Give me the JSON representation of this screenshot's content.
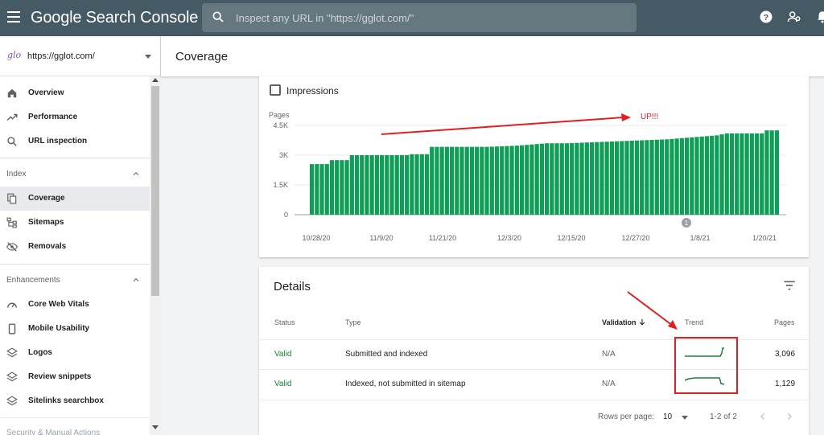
{
  "app": {
    "title": "Google Search Console",
    "search_placeholder": "Inspect any URL in \"https://gglot.com/\""
  },
  "sidebar": {
    "property_logo": "glo",
    "property": "https://gglot.com/",
    "items_top": [
      {
        "label": "Overview",
        "icon": "home-icon"
      },
      {
        "label": "Performance",
        "icon": "trending-up-icon"
      },
      {
        "label": "URL inspection",
        "icon": "search-icon"
      }
    ],
    "index_section": "Index",
    "index_items": [
      {
        "label": "Coverage",
        "icon": "file-copy-icon",
        "active": true
      },
      {
        "label": "Sitemaps",
        "icon": "sitemap-icon"
      },
      {
        "label": "Removals",
        "icon": "visibility-off-icon"
      }
    ],
    "enh_section": "Enhancements",
    "enh_items": [
      {
        "label": "Core Web Vitals",
        "icon": "speed-icon"
      },
      {
        "label": "Mobile Usability",
        "icon": "phone-icon"
      },
      {
        "label": "Logos",
        "icon": "layers-icon"
      },
      {
        "label": "Review snippets",
        "icon": "layers-icon"
      },
      {
        "label": "Sitelinks searchbox",
        "icon": "layers-icon"
      }
    ],
    "cut_item": "Security & Manual Actions"
  },
  "header": {
    "title": "Coverage"
  },
  "chart": {
    "checkbox_label": "Impressions",
    "checked": false,
    "annotation_marker": "1",
    "annotation_text": "UP!!!"
  },
  "chart_data": {
    "type": "bar",
    "ylabel": "Pages",
    "yticks": [
      "0",
      "1.5K",
      "3K",
      "4.5K"
    ],
    "ylim": [
      0,
      4500
    ],
    "xticks": [
      "10/28/20",
      "11/9/20",
      "11/21/20",
      "12/3/20",
      "12/15/20",
      "12/27/20",
      "1/8/21",
      "1/20/21"
    ],
    "color": "#0f9d58",
    "values": [
      2550,
      2550,
      2550,
      2550,
      2750,
      2750,
      2750,
      2750,
      3000,
      3000,
      3000,
      3000,
      3000,
      3000,
      3000,
      3000,
      3000,
      3000,
      3000,
      3000,
      3050,
      3050,
      3050,
      3050,
      3420,
      3420,
      3420,
      3420,
      3420,
      3420,
      3420,
      3420,
      3420,
      3420,
      3420,
      3420,
      3430,
      3440,
      3450,
      3460,
      3470,
      3480,
      3500,
      3520,
      3540,
      3560,
      3580,
      3600,
      3600,
      3600,
      3600,
      3600,
      3610,
      3620,
      3630,
      3640,
      3650,
      3660,
      3670,
      3680,
      3690,
      3700,
      3710,
      3720,
      3730,
      3740,
      3750,
      3760,
      3770,
      3780,
      3790,
      3800,
      3820,
      3840,
      3860,
      3880,
      3900,
      3920,
      3940,
      3960,
      3980,
      4000,
      4050,
      4100,
      4100,
      4100,
      4100,
      4100,
      4100,
      4100,
      4100,
      4250,
      4250,
      4250
    ]
  },
  "details": {
    "title": "Details",
    "columns": {
      "status": "Status",
      "type": "Type",
      "validation": "Validation",
      "trend": "Trend",
      "pages": "Pages"
    },
    "rows": [
      {
        "status": "Valid",
        "type": "Submitted and indexed",
        "validation": "N/A",
        "pages": "3,096"
      },
      {
        "status": "Valid",
        "type": "Indexed, not submitted in sitemap",
        "validation": "N/A",
        "pages": "1,129"
      }
    ],
    "rows_per_page_label": "Rows per page:",
    "rows_per_page": "10",
    "range": "1-2 of 2"
  }
}
